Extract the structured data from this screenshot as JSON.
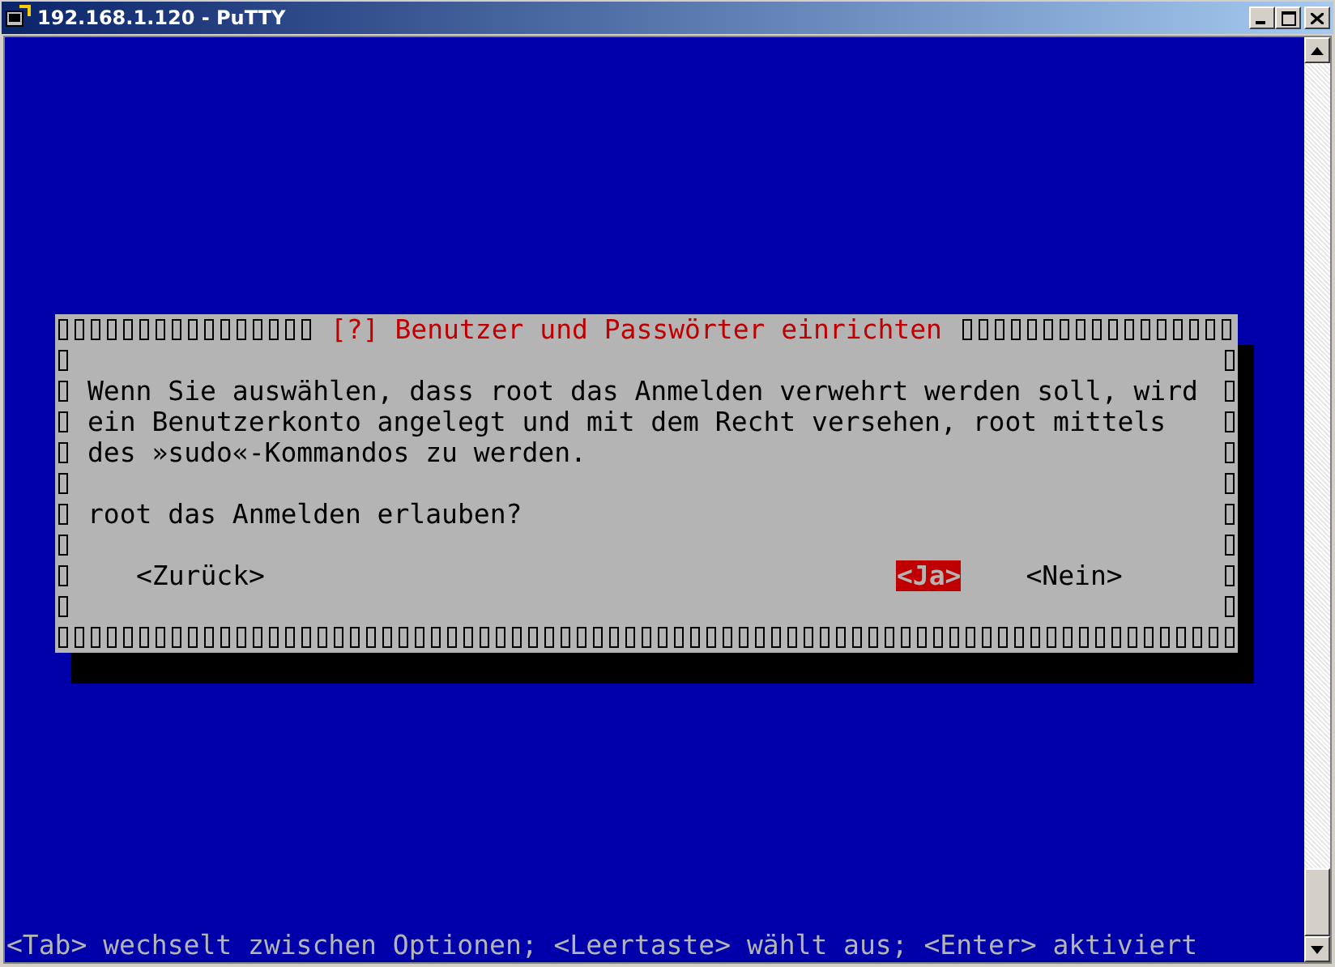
{
  "window": {
    "title": "192.168.1.120 - PuTTY"
  },
  "dialog": {
    "title": "[?] Benutzer und Passwörter einrichten",
    "message_lines": [
      "Wenn Sie auswählen, dass root das Anmelden verwehrt werden soll, wird",
      "ein Benutzerkonto angelegt und mit dem Recht versehen, root mittels",
      "des »sudo«-Kommandos zu werden."
    ],
    "question": "root das Anmelden erlauben?",
    "buttons": [
      {
        "label": "<Zurück>",
        "selected": false
      },
      {
        "label": "<Ja>",
        "selected": true
      },
      {
        "label": "<Nein>",
        "selected": false
      }
    ]
  },
  "status_line": "<Tab> wechselt zwischen Optionen; <Leertaste> wählt aus; <Enter> aktiviert"
}
